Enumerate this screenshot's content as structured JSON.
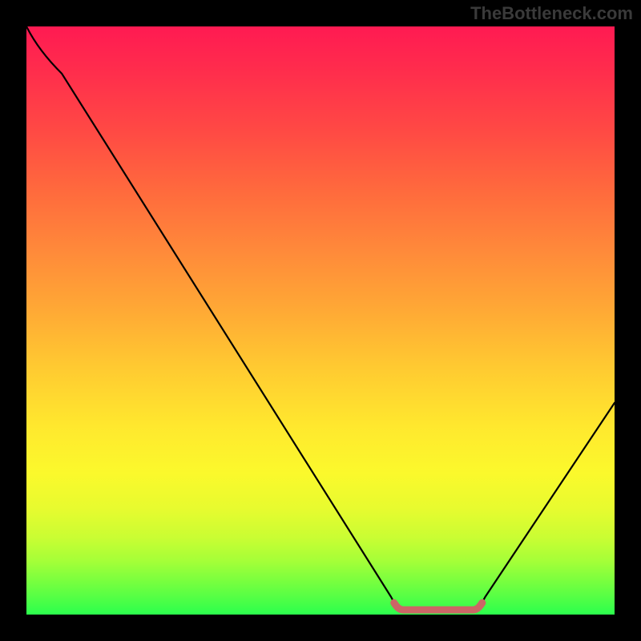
{
  "watermark": "TheBottleneck.com",
  "chart_data": {
    "type": "line",
    "title": "",
    "xlabel": "",
    "ylabel": "",
    "xlim": [
      0,
      100
    ],
    "ylim": [
      0,
      100
    ],
    "series": [
      {
        "name": "bottleneck-curve",
        "points": [
          [
            0,
            100
          ],
          [
            6,
            92
          ],
          [
            62,
            3
          ],
          [
            64,
            1
          ],
          [
            76,
            1
          ],
          [
            78,
            3
          ],
          [
            100,
            36
          ]
        ],
        "color": "#000000"
      },
      {
        "name": "optimal-range-marker",
        "points": [
          [
            62.5,
            2.0
          ],
          [
            64,
            0.8
          ],
          [
            76,
            0.8
          ],
          [
            77.5,
            2.0
          ]
        ],
        "color": "#cc6666",
        "thick": true
      }
    ],
    "gradient_stops": [
      {
        "pos": 0,
        "color": "#ff1a52"
      },
      {
        "pos": 50,
        "color": "#ffca31"
      },
      {
        "pos": 80,
        "color": "#fbf92c"
      },
      {
        "pos": 100,
        "color": "#2bff4d"
      }
    ]
  }
}
